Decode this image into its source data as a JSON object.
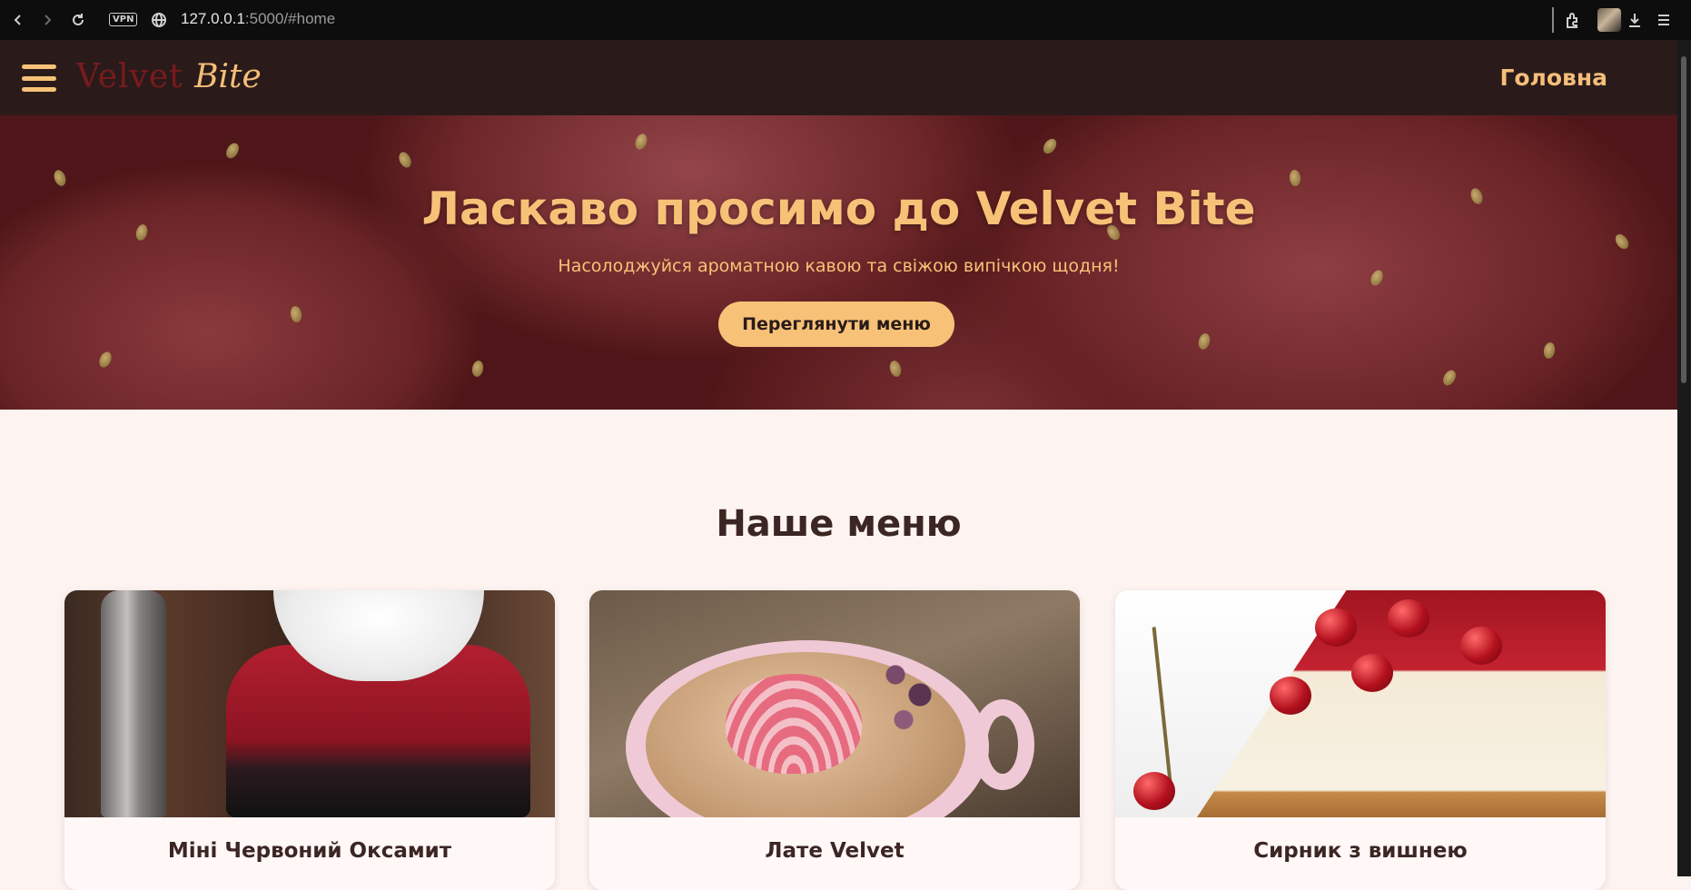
{
  "browser": {
    "vpn_label": "VPN",
    "url_host": "127.0.0.1",
    "url_path": ":5000/#home"
  },
  "header": {
    "logo_part1": "Velvet ",
    "logo_part2": "Bite",
    "nav_home": "Головна"
  },
  "hero": {
    "title": "Ласкаво просимо до Velvet Bite",
    "subtitle": "Насолоджуйся ароматною кавою та свіжою випічкою щодня!",
    "button_label": "Переглянути меню"
  },
  "menu": {
    "heading": "Наше меню",
    "items": [
      {
        "name": "Міні Червоний Оксамит"
      },
      {
        "name": "Лате Velvet"
      },
      {
        "name": "Сирник з вишнею"
      }
    ]
  },
  "colors": {
    "header_bg": "#2a1b1a",
    "accent": "#f7c277",
    "brand_red": "#7a1a1e",
    "page_bg": "#fdf4f1",
    "text_dark": "#3b2624"
  }
}
